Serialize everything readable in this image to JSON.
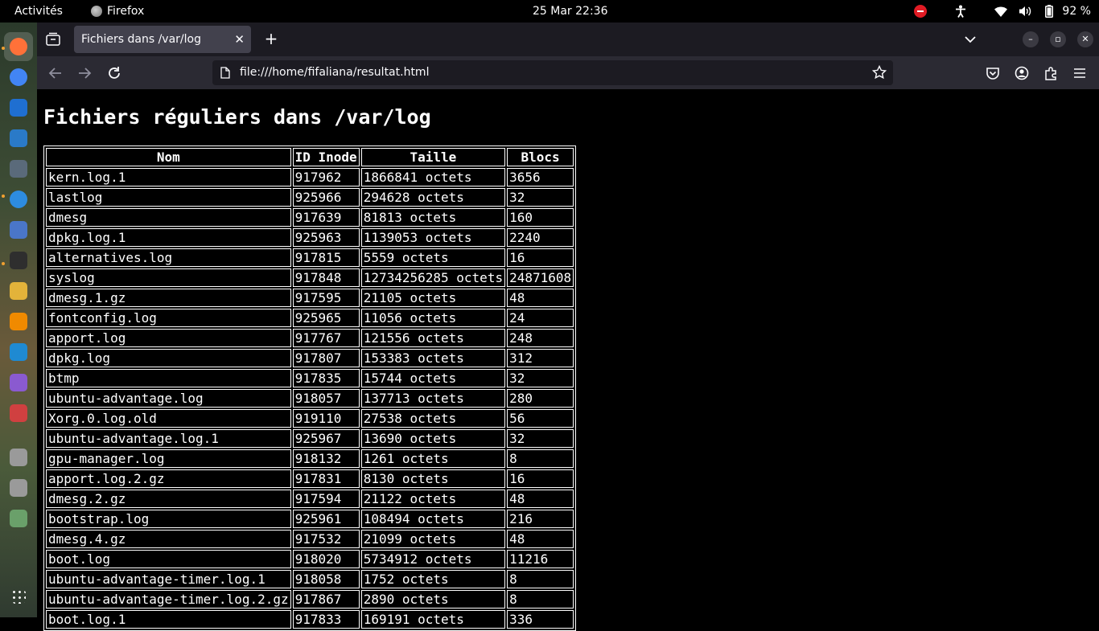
{
  "topbar": {
    "activities": "Activités",
    "app_name": "Firefox",
    "clock": "25 Mar  22:36",
    "battery_pct": "92 %"
  },
  "browser": {
    "tab_title": "Fichiers dans /var/log",
    "tab_close": "✕",
    "new_tab": "+",
    "url": "file:///home/fifaliana/resultat.html"
  },
  "page": {
    "title": "Fichiers réguliers dans /var/log",
    "columns": [
      "Nom",
      "ID Inode",
      "Taille",
      "Blocs"
    ],
    "rows": [
      [
        "kern.log.1",
        "917962",
        "1866841 octets",
        "3656"
      ],
      [
        "lastlog",
        "925966",
        "294628 octets",
        "32"
      ],
      [
        "dmesg",
        "917639",
        "81813 octets",
        "160"
      ],
      [
        "dpkg.log.1",
        "925963",
        "1139053 octets",
        "2240"
      ],
      [
        "alternatives.log",
        "917815",
        "5559 octets",
        "16"
      ],
      [
        "syslog",
        "917848",
        "12734256285 octets",
        "24871608"
      ],
      [
        "dmesg.1.gz",
        "917595",
        "21105 octets",
        "48"
      ],
      [
        "fontconfig.log",
        "925965",
        "11056 octets",
        "24"
      ],
      [
        "apport.log",
        "917767",
        "121556 octets",
        "248"
      ],
      [
        "dpkg.log",
        "917807",
        "153383 octets",
        "312"
      ],
      [
        "btmp",
        "917835",
        "15744 octets",
        "32"
      ],
      [
        "ubuntu-advantage.log",
        "918057",
        "137713 octets",
        "280"
      ],
      [
        "Xorg.0.log.old",
        "919110",
        "27538 octets",
        "56"
      ],
      [
        "ubuntu-advantage.log.1",
        "925967",
        "13690 octets",
        "32"
      ],
      [
        "gpu-manager.log",
        "918132",
        "1261 octets",
        "8"
      ],
      [
        "apport.log.2.gz",
        "917831",
        "8130 octets",
        "16"
      ],
      [
        "dmesg.2.gz",
        "917594",
        "21122 octets",
        "48"
      ],
      [
        "bootstrap.log",
        "925961",
        "108494 octets",
        "216"
      ],
      [
        "dmesg.4.gz",
        "917532",
        "21099 octets",
        "48"
      ],
      [
        "boot.log",
        "918020",
        "5734912 octets",
        "11216"
      ],
      [
        "ubuntu-advantage-timer.log.1",
        "918058",
        "1752 octets",
        "8"
      ],
      [
        "ubuntu-advantage-timer.log.2.gz",
        "917867",
        "2890 octets",
        "8"
      ],
      [
        "boot.log.1",
        "917833",
        "169191 octets",
        "336"
      ]
    ]
  },
  "dock": {
    "items": [
      {
        "name": "firefox-icon",
        "color": "#ff7139",
        "active": true
      },
      {
        "name": "chrome-icon",
        "color": "#4285f4",
        "active": false
      },
      {
        "name": "thunderbird-icon",
        "color": "#1f6fd1",
        "active": false
      },
      {
        "name": "writer-icon",
        "color": "#2a7ac8",
        "active": false
      },
      {
        "name": "files-icon",
        "color": "#5a6a7a",
        "active": false
      },
      {
        "name": "help-icon",
        "color": "#2d8ce0",
        "active": false
      },
      {
        "name": "text-editor-icon",
        "color": "#4a76c8",
        "active": false
      },
      {
        "name": "terminal-icon",
        "color": "#2e2e2e",
        "active": false
      },
      {
        "name": "games-icon",
        "color": "#e3b33a",
        "active": false
      },
      {
        "name": "vlc-icon",
        "color": "#f08a00",
        "active": false
      },
      {
        "name": "vscode-icon",
        "color": "#1f8ad2",
        "active": false
      },
      {
        "name": "app-icon",
        "color": "#8a5ad0",
        "active": false
      },
      {
        "name": "document-viewer-icon",
        "color": "#d04040",
        "active": false
      },
      {
        "name": "drive-icon",
        "color": "#9a9a9a",
        "active": false
      },
      {
        "name": "drive-2-icon",
        "color": "#9a9a9a",
        "active": false
      },
      {
        "name": "trash-icon",
        "color": "#6aa06a",
        "active": false
      },
      {
        "name": "app-grid-icon",
        "color": "#ffffff",
        "active": false
      }
    ]
  }
}
